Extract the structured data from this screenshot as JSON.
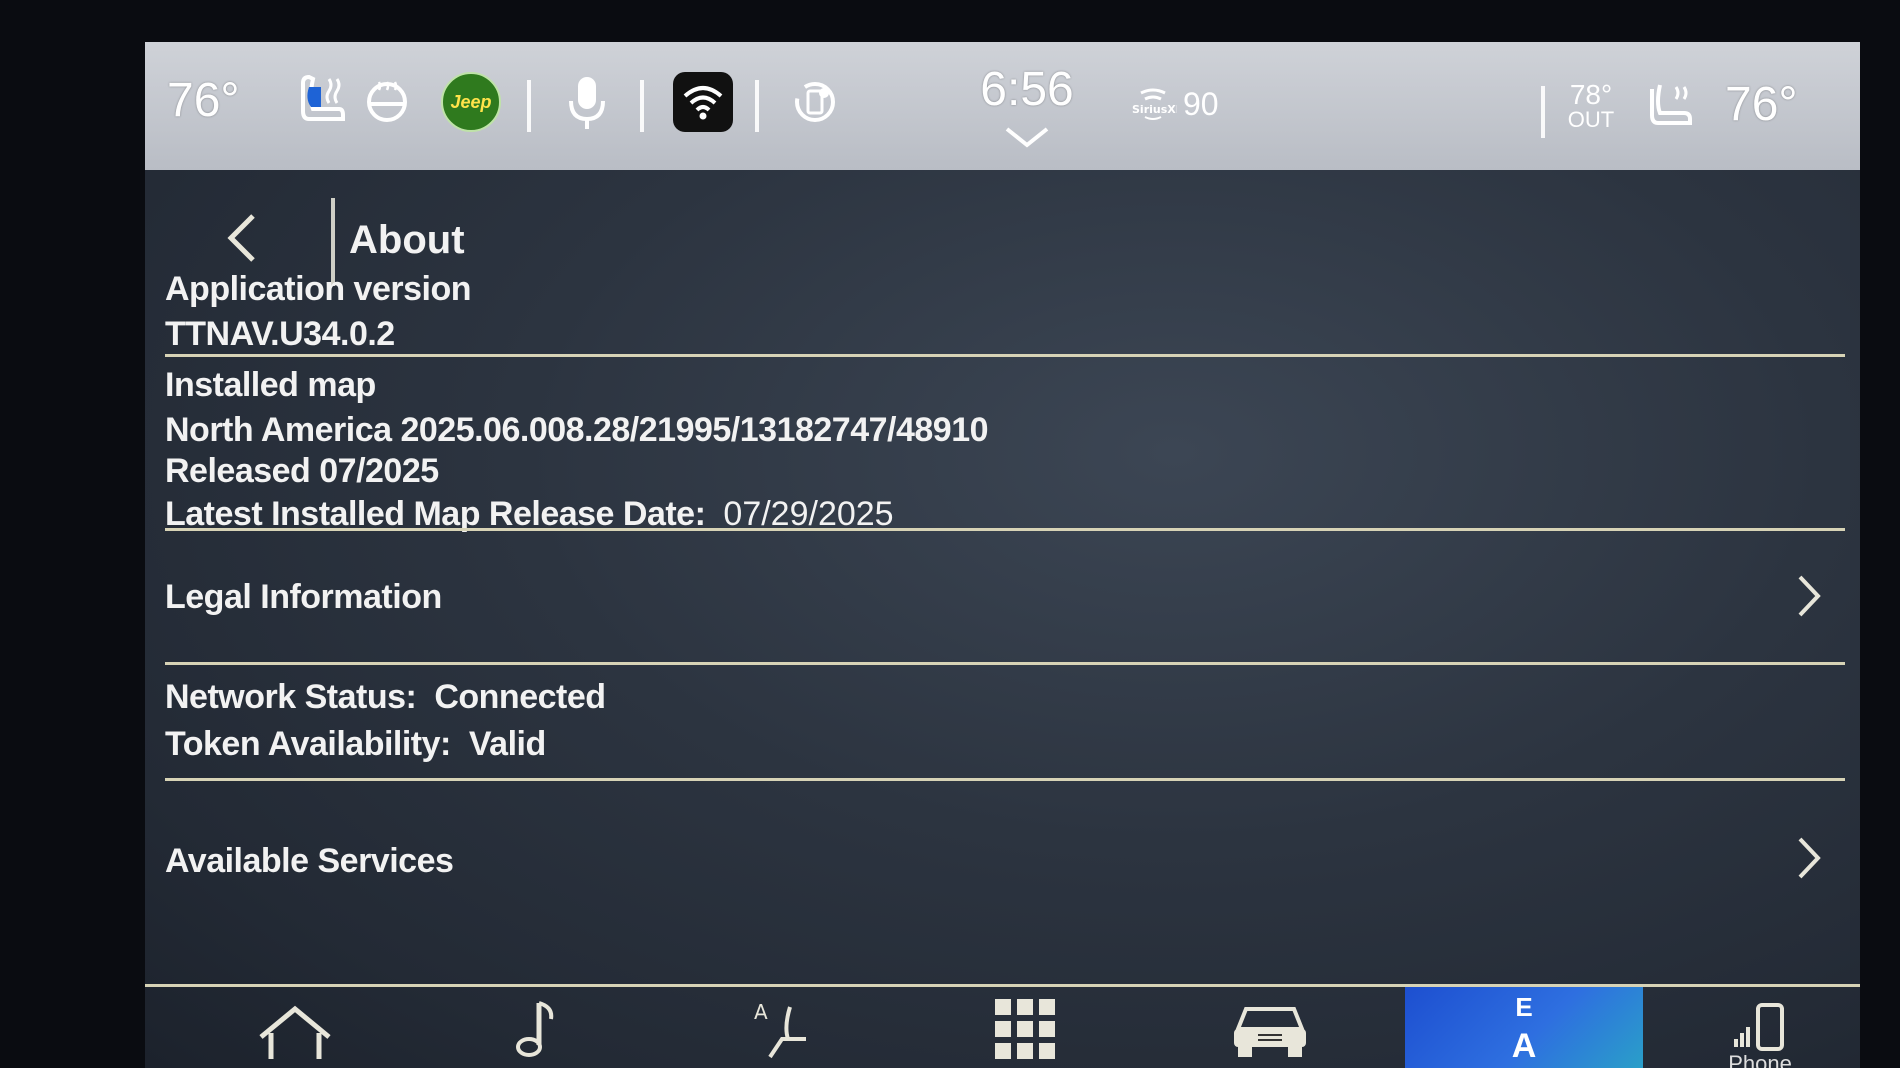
{
  "status_bar": {
    "driver_temp": "76°",
    "brand_badge": "Jeep",
    "clock": "6:56",
    "radio_brand": "SiriusXM",
    "radio_channel": "90",
    "outside_temp_value": "78°",
    "outside_temp_label": "OUT",
    "passenger_temp": "76°"
  },
  "header": {
    "title": "About"
  },
  "about": {
    "app_version_label": "Application version",
    "app_version_value": "TTNAV.U34.0.2",
    "installed_map_label": "Installed map",
    "map_name": "North America 2025.06.008.28/21995/13182747/48910",
    "map_released": "Released 07/2025",
    "latest_release_label": "Latest Installed Map Release Date:",
    "latest_release_value": "07/29/2025",
    "legal_label": "Legal Information",
    "network_label": "Network Status:",
    "network_value": "Connected",
    "token_label": "Token Availability:",
    "token_value": "Valid",
    "services_label": "Available Services"
  },
  "bottom_nav": {
    "compass_top": "E",
    "compass_bottom": "A",
    "phone_label": "Phone"
  },
  "colors": {
    "divider": "#d7d3b6",
    "active_tab": "#1d4fd0",
    "jeep_badge": "#2f7a1e"
  }
}
